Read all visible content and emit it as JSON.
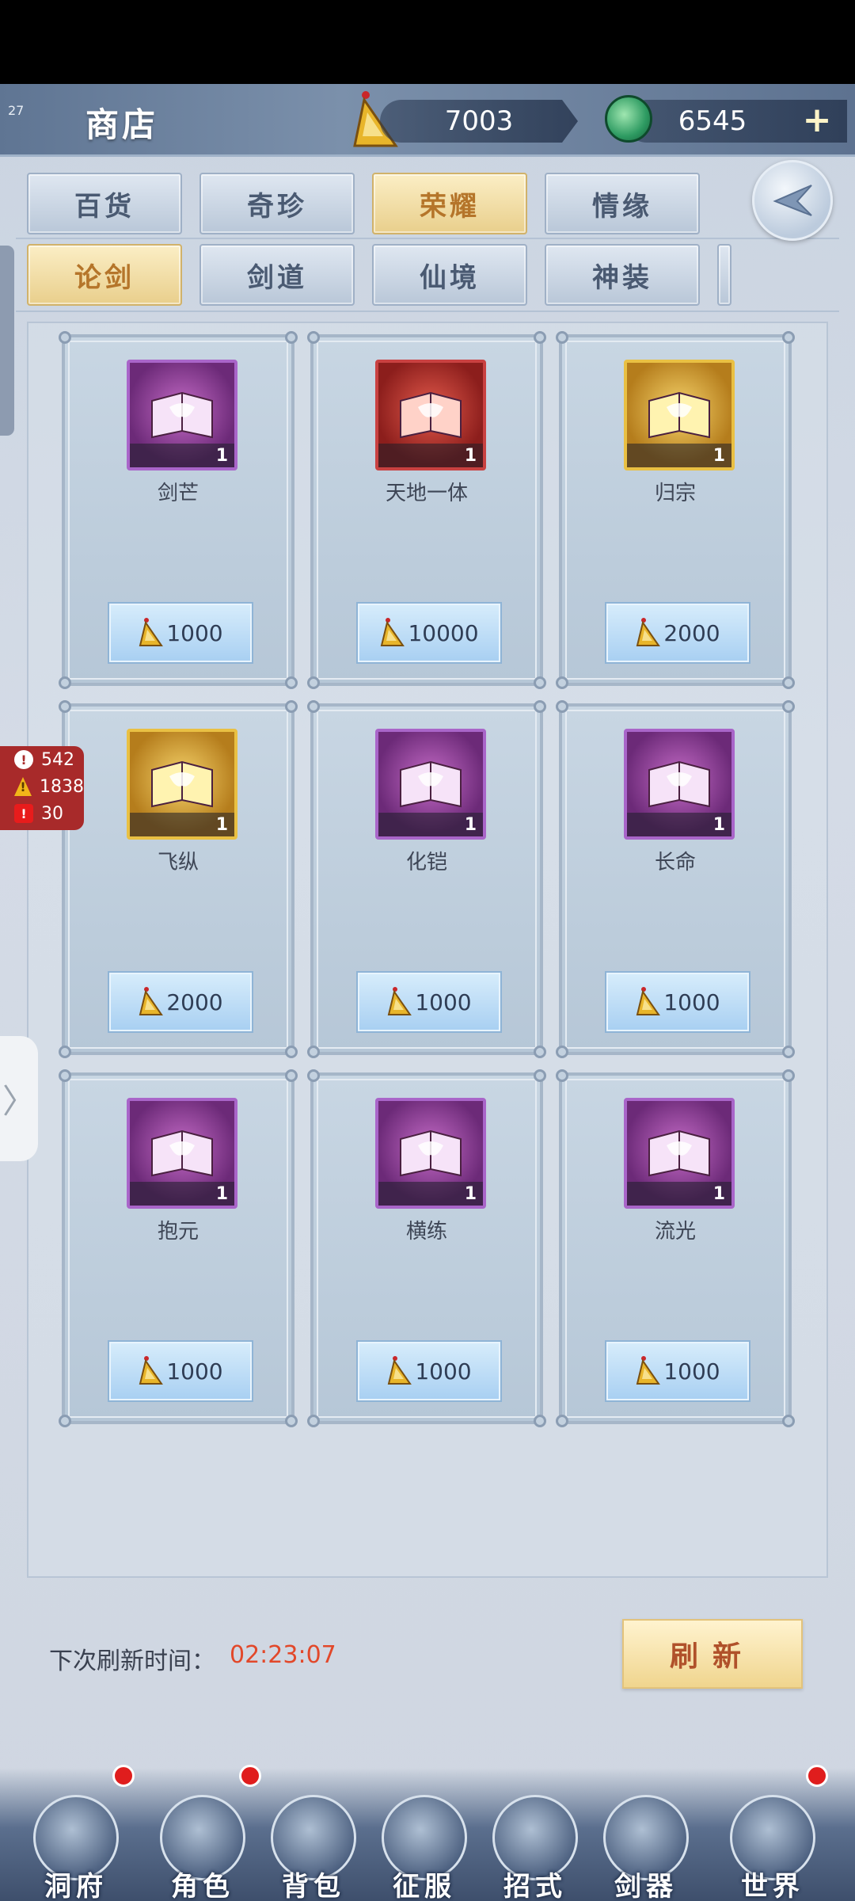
{
  "header": {
    "corner_number": "27",
    "title": "商店",
    "currency_primary": "7003",
    "currency_secondary": "6545",
    "plus_label": "+"
  },
  "tabs_row1": [
    {
      "label": "百货",
      "active": false
    },
    {
      "label": "奇珍",
      "active": false
    },
    {
      "label": "荣耀",
      "active": true
    },
    {
      "label": "情缘",
      "active": false
    }
  ],
  "tabs_row2": [
    {
      "label": "论剑",
      "active": true
    },
    {
      "label": "剑道",
      "active": false
    },
    {
      "label": "仙境",
      "active": false
    },
    {
      "label": "神装",
      "active": false
    }
  ],
  "items": [
    {
      "name": "剑芒",
      "price": "1000",
      "qty": "1",
      "rarity": "purple"
    },
    {
      "name": "天地一体",
      "price": "10000",
      "qty": "1",
      "rarity": "red"
    },
    {
      "name": "归宗",
      "price": "2000",
      "qty": "1",
      "rarity": "gold"
    },
    {
      "name": "飞纵",
      "price": "2000",
      "qty": "1",
      "rarity": "gold"
    },
    {
      "name": "化铠",
      "price": "1000",
      "qty": "1",
      "rarity": "purple"
    },
    {
      "name": "长命",
      "price": "1000",
      "qty": "1",
      "rarity": "purple"
    },
    {
      "name": "抱元",
      "price": "1000",
      "qty": "1",
      "rarity": "purple"
    },
    {
      "name": "横练",
      "price": "1000",
      "qty": "1",
      "rarity": "purple"
    },
    {
      "name": "流光",
      "price": "1000",
      "qty": "1",
      "rarity": "purple"
    }
  ],
  "warnings": {
    "info": "542",
    "warn": "1838",
    "error": "30"
  },
  "side_handle": "〉",
  "refresh": {
    "label": "下次刷新时间：",
    "time": "02:23:07",
    "button": "刷新"
  },
  "bottom_nav": [
    {
      "label": "洞府",
      "badge": true
    },
    {
      "label": "角色",
      "badge": true
    },
    {
      "label": "背包",
      "badge": false
    },
    {
      "label": "征服",
      "badge": false
    },
    {
      "label": "招式",
      "badge": false
    },
    {
      "label": "剑器",
      "badge": false
    },
    {
      "label": "世界",
      "badge": true
    }
  ],
  "colors": {
    "tab_active": "#e9cf8c",
    "price_button": "#a9d0f2",
    "refresh_time": "#e2482a",
    "badge": "#e01d1d"
  }
}
